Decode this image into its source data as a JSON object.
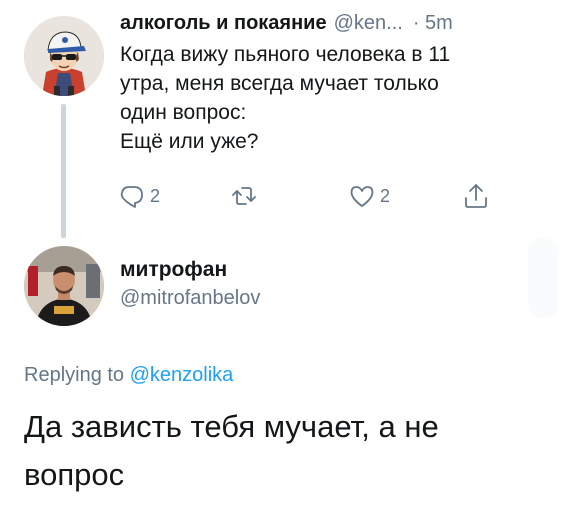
{
  "tweet1": {
    "author_name": "алкоголь и покаяние",
    "author_handle": "@ken...",
    "time": "· 5m",
    "text": "Когда вижу пьяного человека в 11\nутра, меня всегда мучает только\nодин вопрос:\nЕщё или уже?",
    "reply_count": "2",
    "retweet_count": "",
    "like_count": "2",
    "avatar_icon": "cartoon-boy-avatar"
  },
  "tweet2": {
    "author_name": "митрофан",
    "author_handle": "@mitrofanbelov",
    "replying_label": "Replying to",
    "replying_to": "@kenzolika",
    "text": "Да зависть тебя мучает, а не\nвопрос",
    "avatar_icon": "man-photo-avatar"
  },
  "colors": {
    "text": "#14171a",
    "secondary": "#657786",
    "link": "#1da1f2",
    "thread_line": "#ccd6dd"
  }
}
